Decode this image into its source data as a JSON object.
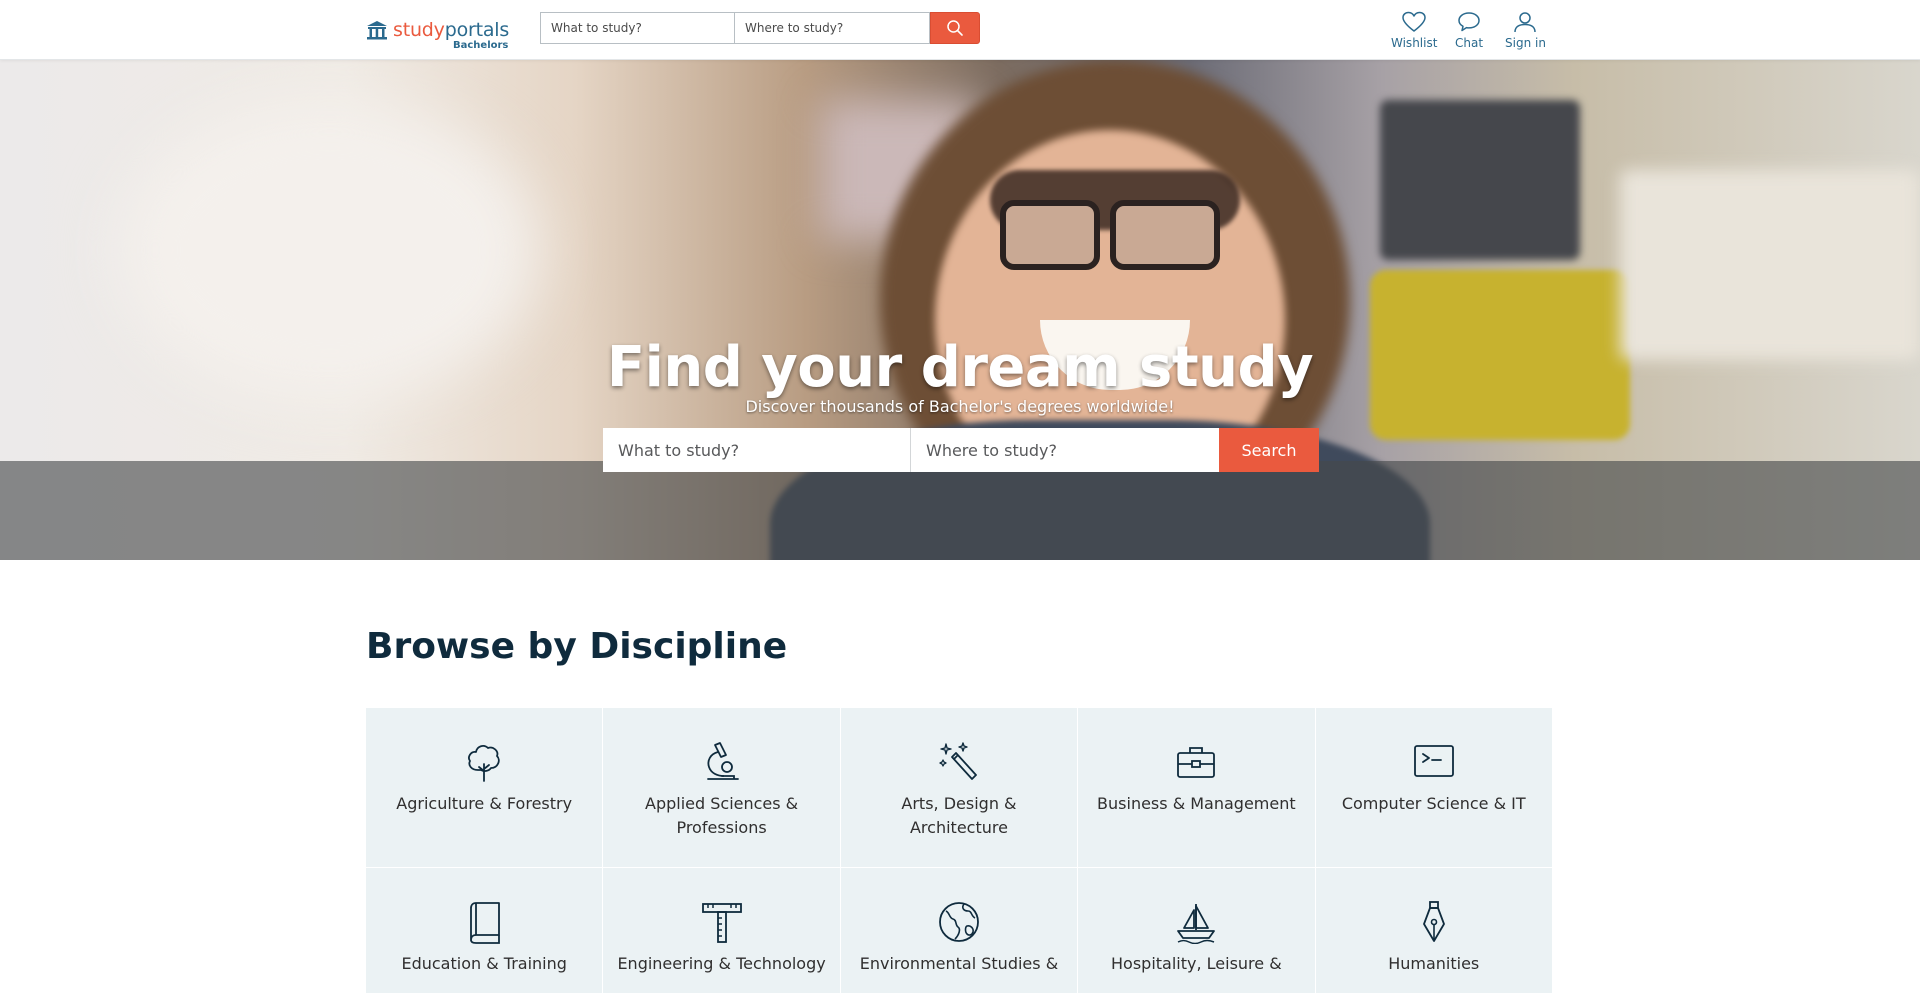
{
  "header": {
    "logo": {
      "study": "study",
      "portals": "portals",
      "sub": "Bachelors"
    },
    "search": {
      "what_placeholder": "What to study?",
      "where_placeholder": "Where to study?"
    },
    "nav": {
      "wishlist": "Wishlist",
      "chat": "Chat",
      "signin": "Sign in"
    }
  },
  "hero": {
    "title": "Find your dream study",
    "subtitle": "Discover thousands of Bachelor's degrees worldwide!",
    "search": {
      "what_placeholder": "What to study?",
      "where_placeholder": "Where to study?",
      "button": "Search"
    }
  },
  "disciplines": {
    "title": "Browse by Discipline",
    "items": [
      {
        "label": "Agriculture & Forestry",
        "icon": "tree-icon"
      },
      {
        "label": "Applied Sciences & Professions",
        "icon": "microscope-icon"
      },
      {
        "label": "Arts, Design & Architecture",
        "icon": "magic-wand-icon"
      },
      {
        "label": "Business & Management",
        "icon": "briefcase-icon"
      },
      {
        "label": "Computer Science & IT",
        "icon": "terminal-icon"
      },
      {
        "label": "Education & Training",
        "icon": "book-icon"
      },
      {
        "label": "Engineering & Technology",
        "icon": "t-square-icon"
      },
      {
        "label": "Environmental Studies &",
        "icon": "globe-icon"
      },
      {
        "label": "Hospitality, Leisure &",
        "icon": "sailboat-icon"
      },
      {
        "label": "Humanities",
        "icon": "pen-nib-icon"
      }
    ]
  },
  "colors": {
    "accent": "#ea5a3e",
    "brand": "#2b6a8e",
    "tile_bg": "#ebf2f4",
    "heading": "#0f2b3d"
  }
}
